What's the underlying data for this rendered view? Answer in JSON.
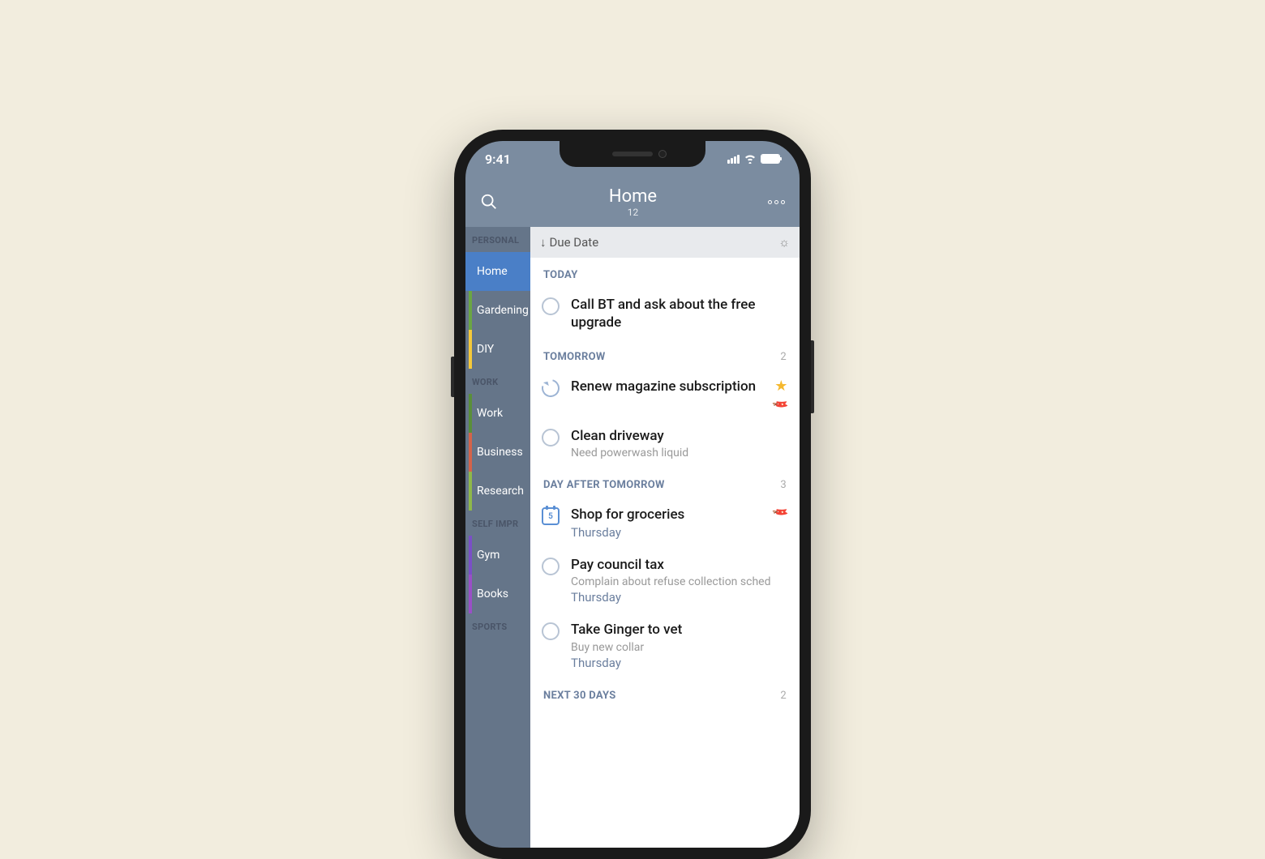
{
  "status": {
    "time": "9:41"
  },
  "header": {
    "title": "Home",
    "count": "12"
  },
  "sort": {
    "label": "Due Date"
  },
  "sidebar": {
    "sections": [
      {
        "label": "PERSONAL",
        "items": [
          {
            "label": "Home",
            "color": "#4a7fc7",
            "active": true
          },
          {
            "label": "Gardening",
            "color": "#6ba644"
          },
          {
            "label": "DIY",
            "color": "#f5c93a"
          }
        ]
      },
      {
        "label": "WORK",
        "items": [
          {
            "label": "Work",
            "color": "#5a8f3a"
          },
          {
            "label": "Business",
            "color": "#d4634a"
          },
          {
            "label": "Research",
            "color": "#8fb84a"
          }
        ]
      },
      {
        "label": "SELF IMPR",
        "items": [
          {
            "label": "Gym",
            "color": "#7a4fc7"
          },
          {
            "label": "Books",
            "color": "#9a4fc7"
          }
        ]
      },
      {
        "label": "SPORTS",
        "items": []
      }
    ]
  },
  "sections": [
    {
      "title": "TODAY",
      "count": "",
      "tasks": [
        {
          "icon": "check",
          "title": "Call BT and ask about the free upgrade",
          "note": "",
          "date": "",
          "starred": false,
          "tagged": false
        }
      ]
    },
    {
      "title": "TOMORROW",
      "count": "2",
      "tasks": [
        {
          "icon": "repeat",
          "title": "Renew magazine subscription",
          "note": "",
          "date": "",
          "starred": true,
          "tagged": true
        },
        {
          "icon": "check",
          "title": "Clean driveway",
          "note": "Need powerwash liquid",
          "date": "",
          "starred": false,
          "tagged": false
        }
      ]
    },
    {
      "title": "DAY AFTER TOMORROW",
      "count": "3",
      "tasks": [
        {
          "icon": "cal",
          "cal": "5",
          "title": "Shop for groceries",
          "note": "",
          "date": "Thursday",
          "starred": false,
          "tagged": true
        },
        {
          "icon": "check",
          "title": "Pay council tax",
          "note": "Complain about refuse collection sched",
          "date": "Thursday",
          "starred": false,
          "tagged": false
        },
        {
          "icon": "check",
          "title": "Take Ginger to vet",
          "note": "Buy new collar",
          "date": "Thursday",
          "starred": false,
          "tagged": false
        }
      ]
    },
    {
      "title": "NEXT 30 DAYS",
      "count": "2",
      "tasks": []
    }
  ]
}
